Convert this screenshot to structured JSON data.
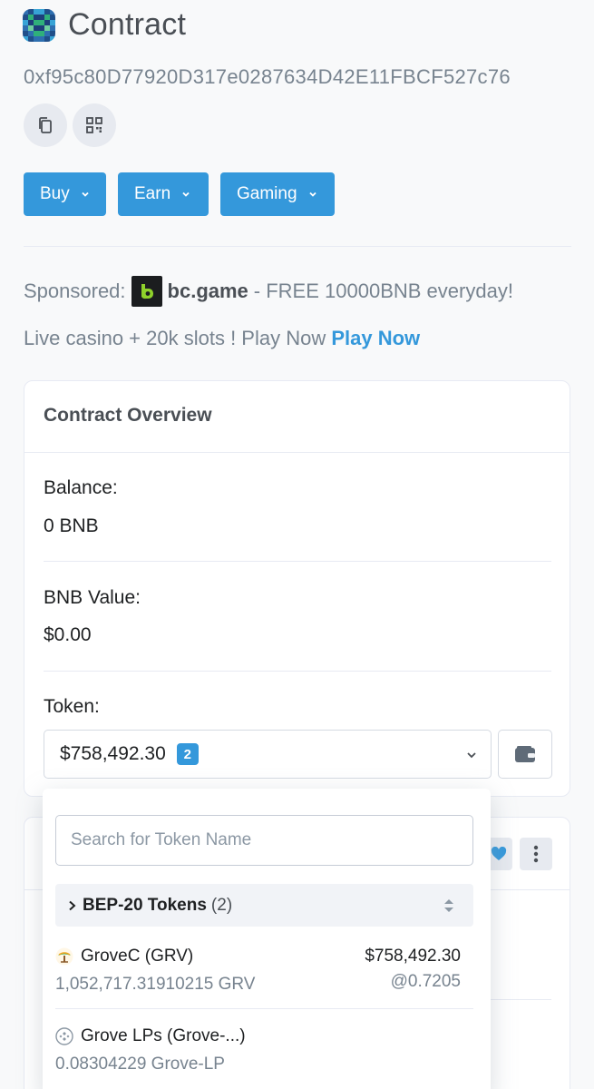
{
  "header": {
    "title": "Contract",
    "address": "0xf95c80D77920D317e0287634D42E11FBCF527c76",
    "copy_icon": "copy-icon",
    "qr_icon": "qr-code-icon"
  },
  "menus": [
    {
      "label": "Buy"
    },
    {
      "label": "Earn"
    },
    {
      "label": "Gaming"
    }
  ],
  "sponsor": {
    "prefix": "Sponsored:",
    "brand": "bc.game",
    "text": "- FREE 10000BNB everyday!",
    "line2": "Live casino + 20k slots ! Play Now",
    "link": "Play Now"
  },
  "overview": {
    "title": "Contract Overview",
    "balance_label": "Balance:",
    "balance_value": "0 BNB",
    "value_label": "BNB Value:",
    "value_value": "$0.00",
    "token_label": "Token:",
    "token_total": "$758,492.30",
    "token_count": "2"
  },
  "dropdown": {
    "search_placeholder": "Search for Token Name",
    "group_title": "BEP-20 Tokens",
    "group_count": "(2)",
    "tokens": [
      {
        "name": "GroveC (GRV)",
        "amount": "1,052,717.31910215 GRV",
        "usd": "$758,492.30",
        "rate": "@0.7205"
      },
      {
        "name": "Grove LPs (Grove-...)",
        "amount": "0.08304229 Grove-LP",
        "usd": "",
        "rate": ""
      }
    ]
  },
  "colors": {
    "accent": "#3498db",
    "background": "#f8f9fa",
    "muted_text": "#77838f"
  }
}
